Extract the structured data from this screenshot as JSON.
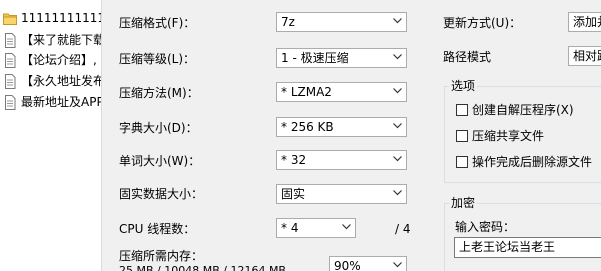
{
  "file_list": [
    {
      "label": "11111111111"
    },
    {
      "label": "【来了就能下载"
    },
    {
      "label": "【论坛介绍】,"
    },
    {
      "label": "【永久地址发布"
    },
    {
      "label": "最新地址及APP"
    }
  ],
  "options": {
    "format": {
      "label": "压缩格式(F)：",
      "value": "7z"
    },
    "level": {
      "label": "压缩等级(L)：",
      "value": "1 - 极速压缩"
    },
    "method": {
      "label": "压缩方法(M)：",
      "value": "* LZMA2"
    },
    "dict_size": {
      "label": "字典大小(D)：",
      "value": "* 256 KB"
    },
    "word_size": {
      "label": "单词大小(W)：",
      "value": "* 32"
    },
    "solid_size": {
      "label": "固实数据大小：",
      "value": "固实"
    },
    "cpu_threads": {
      "label": "CPU 线程数：",
      "value": "* 4",
      "max": "/ 4"
    },
    "memory": {
      "label": "压缩所需内存：",
      "detail": "25 MB / 10048 MB / 12164 MB",
      "percent": "90%"
    }
  },
  "right": {
    "update_mode": {
      "label": "更新方式(U)：",
      "value": "添加并"
    },
    "path_mode": {
      "label": "路径模式",
      "value": "相对路"
    },
    "options_group": {
      "title": "选项",
      "items": [
        {
          "label": "创建自解压程序(X)"
        },
        {
          "label": "压缩共享文件"
        },
        {
          "label": "操作完成后删除源文件"
        }
      ]
    },
    "encryption_group": {
      "title": "加密",
      "password_label": "输入密码：",
      "password_value": "上老王论坛当老王"
    }
  }
}
